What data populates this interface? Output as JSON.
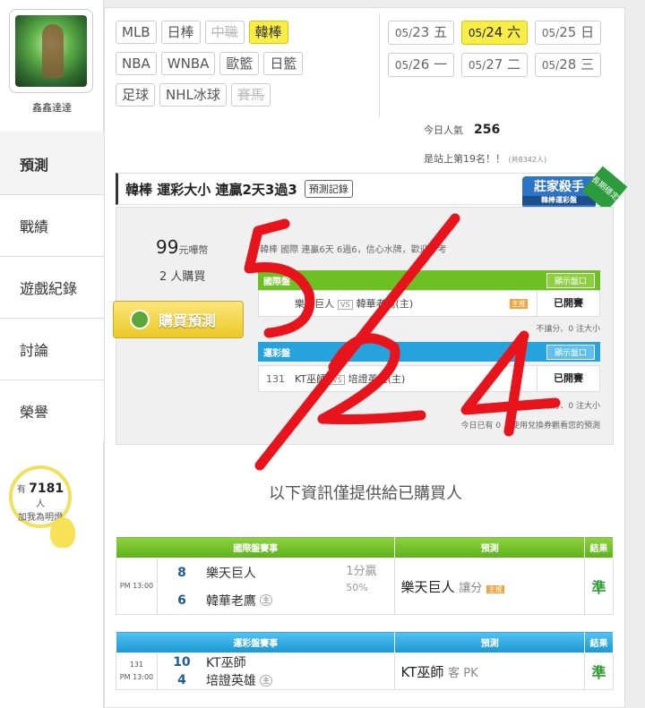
{
  "sidebar": {
    "username": "鑫鑫達達",
    "nav": [
      "預測",
      "戰績",
      "遊戲紀錄",
      "討論",
      "榮譽"
    ],
    "fans": {
      "prefix": "有",
      "count": "7181",
      "suffix": "人",
      "text": "加我為明燈"
    }
  },
  "leagues": {
    "row1": [
      "MLB",
      "日棒",
      "中職",
      "韓棒"
    ],
    "row2": [
      "NBA",
      "WNBA",
      "歐籃",
      "日籃"
    ],
    "row3": [
      "足球",
      "NHL冰球",
      "賽馬"
    ]
  },
  "dates": {
    "row1": [
      {
        "md": "05/",
        "d": "23",
        "w": "五"
      },
      {
        "md": "05/",
        "d": "24",
        "w": "六"
      },
      {
        "md": "05/",
        "d": "25",
        "w": "日"
      }
    ],
    "row2": [
      {
        "md": "05/",
        "d": "26",
        "w": "一"
      },
      {
        "md": "05/",
        "d": "27",
        "w": "二"
      },
      {
        "md": "05/",
        "d": "28",
        "w": "三"
      }
    ]
  },
  "popularity": {
    "label": "今日人氣",
    "value": "256"
  },
  "rank": {
    "text": "是站上第19名！！",
    "note": "(共8342人)"
  },
  "prediction": {
    "title": "韓棒 運彩大小 連贏2天3過3",
    "record_btn": "預測記錄",
    "badge": {
      "name": "莊家殺手",
      "sub": "韓棒運彩盤",
      "ribbon": "長期穩定"
    },
    "price": "99",
    "price_unit": "元嘩幣",
    "buyers": "2 人購買",
    "buy_label": "購買預測",
    "intro": "韓棒 國際 連贏6天 6過6，信心水牌，歡迎參考",
    "group1_title": "國際盤",
    "group2_title": "運彩盤",
    "show_btn": "顯示盤口",
    "game1": {
      "num": "",
      "away": "樂天巨人",
      "vs": "VS",
      "home": "韓華老鷹(主)",
      "tag": "主推",
      "status": "已開賽"
    },
    "game1_note": "不讓分、0 注大小",
    "game2": {
      "num": "131",
      "away": "KT巫師",
      "vs": "VS",
      "home": "培證英雄(主)",
      "status": "已開賽"
    },
    "game2_note": "0 注讓分、0 注大小",
    "footer": "今日已有 0 人使用兌換券觀看您的預測"
  },
  "info_text": "以下資訊僅提供給已購買人",
  "table1": {
    "headers": [
      "國際盤賽事",
      "預測",
      "結果"
    ],
    "time": "PM 13:00",
    "away_score": "8",
    "away": "樂天巨人",
    "home_score": "6",
    "home": "韓華老鷹",
    "home_tag": "主",
    "handicap": "1分贏",
    "handicap_pct": "50%",
    "pick": "樂天巨人",
    "pick_type": "讓分",
    "pick_tag": "主推",
    "result": "準"
  },
  "table2": {
    "headers": [
      "運彩盤賽事",
      "預測",
      "結果"
    ],
    "num": "131",
    "time": "PM 13:00",
    "away_score": "10",
    "away": "KT巫師",
    "home_score": "4",
    "home": "培證英雄",
    "home_tag": "主",
    "pick": "KT巫師",
    "pick_type": "客 PK",
    "result": "準"
  },
  "colors": {
    "selected": "#f8ec46",
    "green": "#6cc024",
    "blue": "#26a3dd",
    "handwriting": "#e8131b"
  }
}
